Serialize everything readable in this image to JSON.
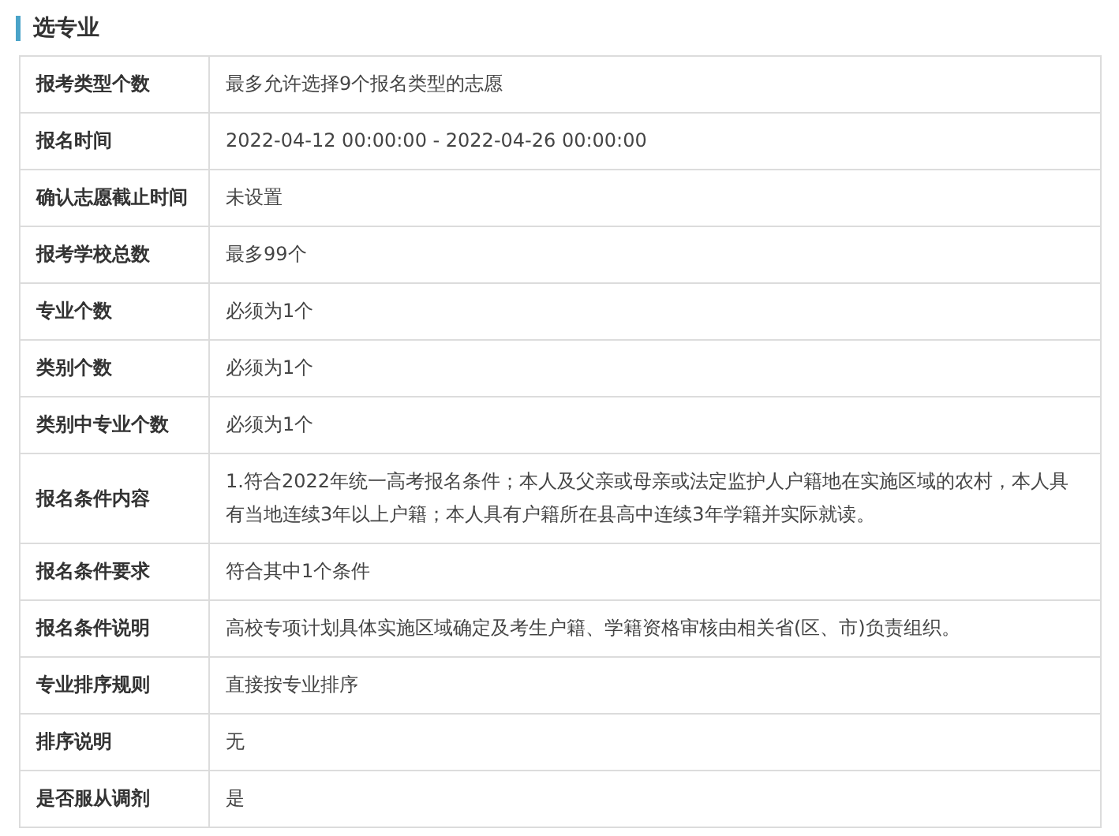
{
  "heading": "选专业",
  "rows": [
    {
      "label": "报考类型个数",
      "value": "最多允许选择9个报名类型的志愿"
    },
    {
      "label": "报名时间",
      "value": "2022-04-12 00:00:00 - 2022-04-26 00:00:00"
    },
    {
      "label": "确认志愿截止时间",
      "value": "未设置"
    },
    {
      "label": "报考学校总数",
      "value": "最多99个"
    },
    {
      "label": "专业个数",
      "value": "必须为1个"
    },
    {
      "label": "类别个数",
      "value": "必须为1个"
    },
    {
      "label": "类别中专业个数",
      "value": "必须为1个"
    },
    {
      "label": "报名条件内容",
      "value": "1.符合2022年统一高考报名条件；本人及父亲或母亲或法定监护人户籍地在实施区域的农村，本人具有当地连续3年以上户籍；本人具有户籍所在县高中连续3年学籍并实际就读。"
    },
    {
      "label": "报名条件要求",
      "value": "符合其中1个条件"
    },
    {
      "label": "报名条件说明",
      "value": "高校专项计划具体实施区域确定及考生户籍、学籍资格审核由相关省(区、市)负责组织。"
    },
    {
      "label": "专业排序规则",
      "value": "直接按专业排序"
    },
    {
      "label": "排序说明",
      "value": "无"
    },
    {
      "label": "是否服从调剂",
      "value": "是"
    }
  ]
}
